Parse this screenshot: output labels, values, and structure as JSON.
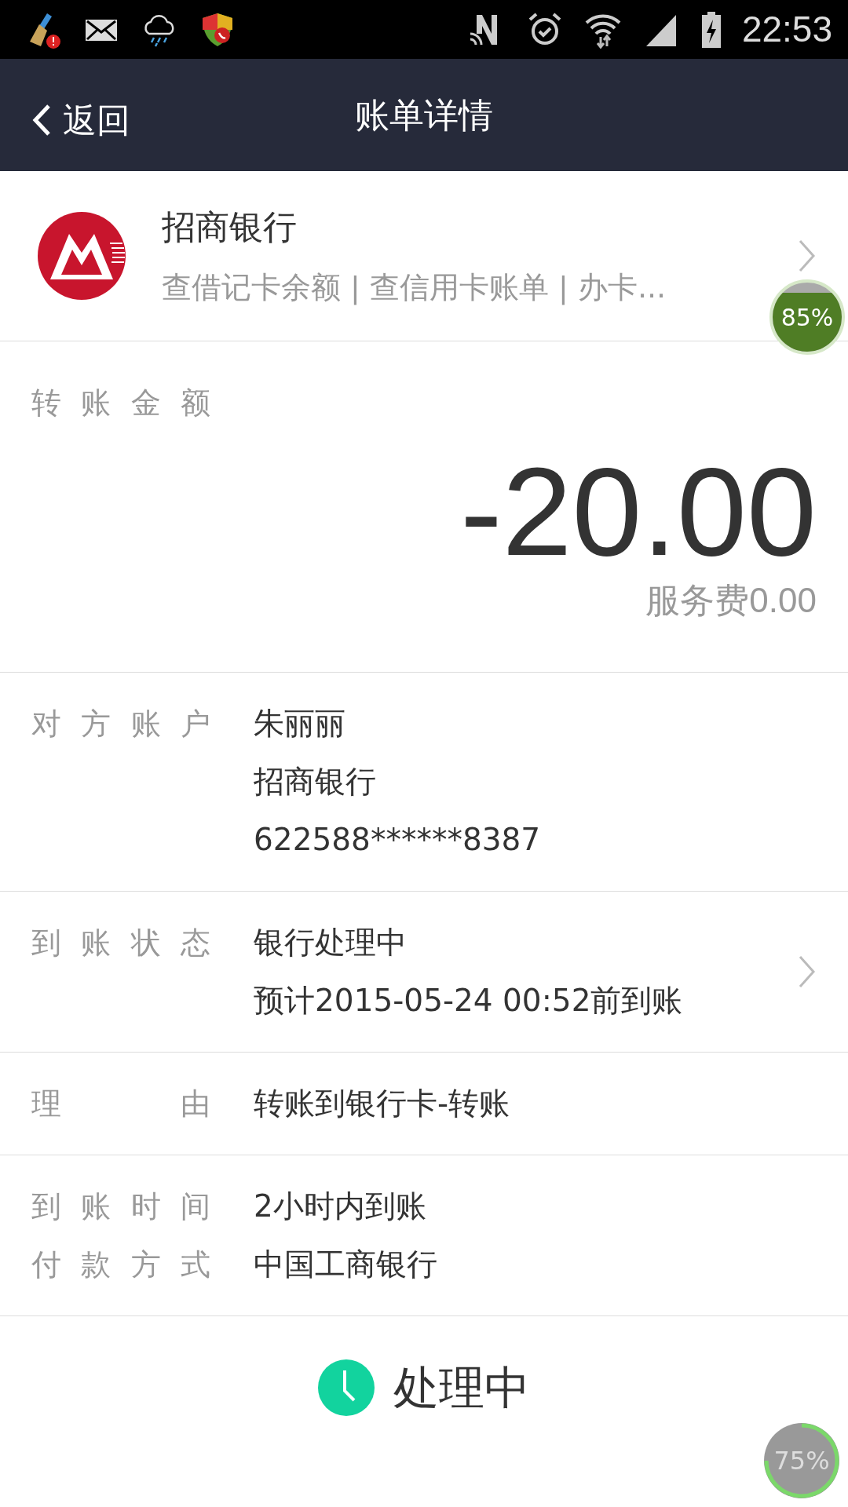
{
  "status_bar": {
    "time": "22:53"
  },
  "header": {
    "back_label": "返回",
    "title": "账单详情"
  },
  "bank": {
    "name": "招商银行",
    "subtitle": "查借记卡余额 | 查信用卡账单 | 办卡..."
  },
  "amount": {
    "label": "转账金额",
    "value": "-20.00",
    "fee": "服务费0.00"
  },
  "details": [
    {
      "chevron": false,
      "items": [
        {
          "label": "对方账户",
          "lines": [
            "朱丽丽",
            "招商银行",
            "622588******8387"
          ]
        }
      ]
    },
    {
      "chevron": true,
      "items": [
        {
          "label": "到账状态",
          "lines": [
            "银行处理中",
            "预计2015-05-24 00:52前到账"
          ]
        }
      ]
    },
    {
      "chevron": false,
      "items": [
        {
          "label": "理由",
          "lines": [
            "转账到银行卡-转账"
          ]
        }
      ]
    },
    {
      "chevron": false,
      "items": [
        {
          "label": "到账时间",
          "lines": [
            "2小时内到账"
          ]
        },
        {
          "label": "付款方式",
          "lines": [
            "中国工商银行"
          ]
        }
      ]
    }
  ],
  "status": {
    "label": "处理中"
  },
  "overlays": [
    {
      "kind": "fill",
      "reading": "85%"
    },
    {
      "kind": "ring",
      "reading": "75%"
    }
  ]
}
